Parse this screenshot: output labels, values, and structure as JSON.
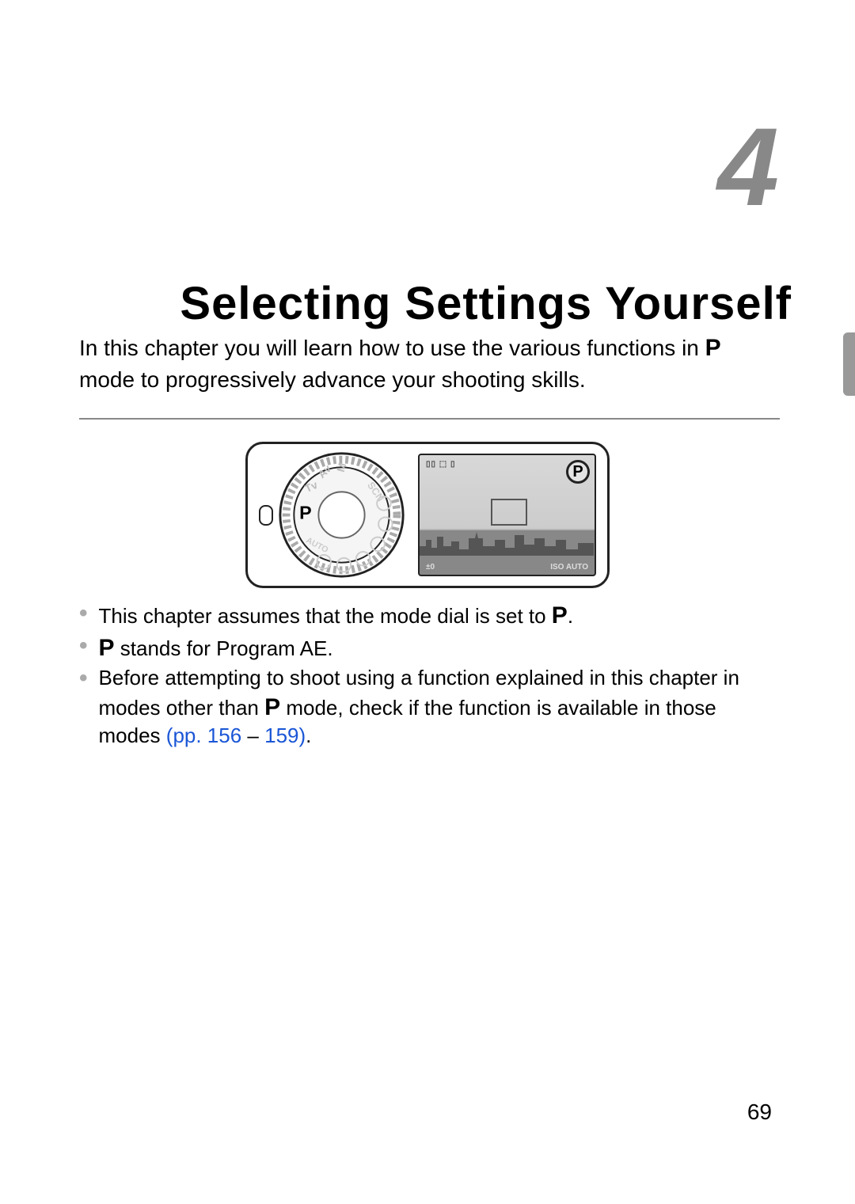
{
  "chapter": {
    "number": "4",
    "title": "Selecting Settings Yourself"
  },
  "intro": {
    "line1_prefix": "In this chapter you will learn how to use the various functions in ",
    "p_icon": "P",
    "line2": " mode to progressively advance your shooting skills."
  },
  "illustration": {
    "dial_modes": [
      "M",
      "Av",
      "Tv",
      "P",
      "AUTO",
      "SCN"
    ],
    "dial_selected": "P",
    "lcd_indicator": "P",
    "lcd_bottom_left": "±0",
    "lcd_bottom_right": "ISO AUTO",
    "lcd_top_icons": "▯▯ ⬚ ▯"
  },
  "notes": [
    {
      "prefix": "This chapter assumes that the mode dial is set to ",
      "icon": "P",
      "suffix": "."
    },
    {
      "icon": "P",
      "suffix": " stands for Program AE."
    },
    {
      "prefix": "Before attempting to shoot using a function explained in this chapter in modes other than ",
      "icon": "P",
      "middle": " mode, check if the function is available in those modes ",
      "link_open": "(pp. 156",
      "dash": " – ",
      "link_close": "159)",
      "suffix": "."
    }
  ],
  "page_number": "69"
}
